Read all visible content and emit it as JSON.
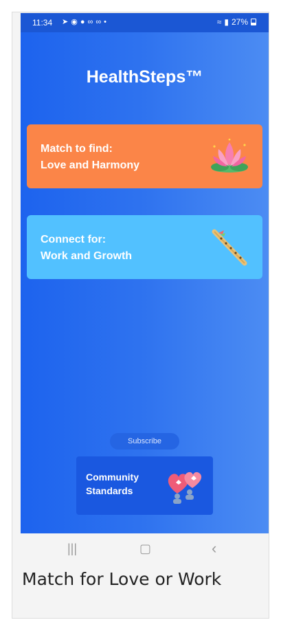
{
  "status_bar": {
    "time": "11:34",
    "notification_icons": [
      "send-icon",
      "messenger-icon",
      "chat-icon",
      "voicemail-icon",
      "voicemail-icon",
      "dot-icon"
    ],
    "battery": "27%"
  },
  "app": {
    "title": "HealthSteps™"
  },
  "cards": [
    {
      "line1": "Match to find:",
      "line2": "Love and Harmony",
      "icon": "lotus-icon",
      "color": "#fb8548"
    },
    {
      "line1": "Connect for:",
      "line2": "Work and Growth",
      "icon": "flute-icon",
      "color": "#52c1ff"
    }
  ],
  "subscribe": {
    "label": "Subscribe"
  },
  "community": {
    "line1": "Community",
    "line2": "Standards",
    "icon": "hearts-people-icon"
  },
  "nav": {
    "recents": "|||",
    "home": "▢",
    "back": "‹"
  },
  "caption": "Match for Love or Work"
}
